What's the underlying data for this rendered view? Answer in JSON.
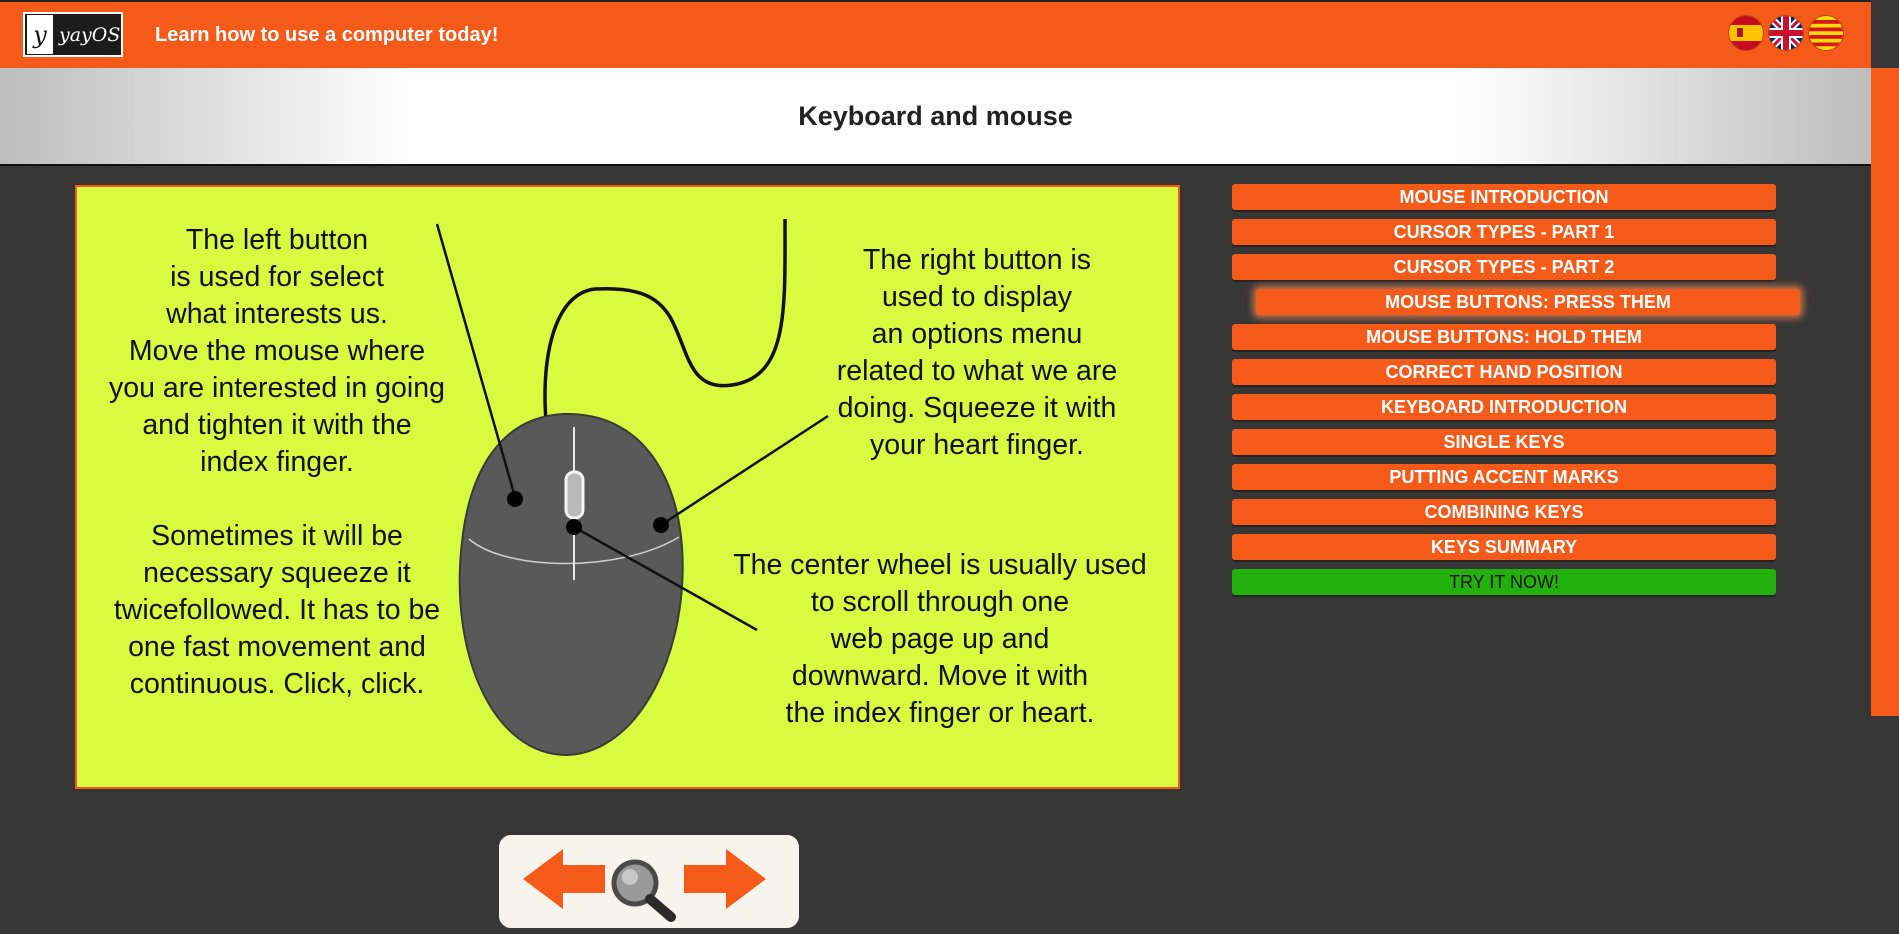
{
  "header": {
    "logo_letter": "y",
    "logo_text": "yayOS",
    "tagline": "Learn how to use a computer today!",
    "languages": [
      "spanish-flag",
      "uk-flag",
      "catalan-flag"
    ]
  },
  "page": {
    "title": "Keyboard and mouse"
  },
  "figure": {
    "left_button_text": "The left button\nis used for select\nwhat interests us.\nMove the mouse where\nyou are interested in going\nand tighten it with the\nindex finger.",
    "double_click_text": "Sometimes it will be\nnecessary squeeze it\ntwicefollowed. It has to be\none fast movement and\ncontinuous. Click, click.",
    "right_button_text": "The right button is\nused to display\nan options menu\nrelated to what we are\ndoing. Squeeze it with\nyour heart finger.",
    "wheel_text": "The center wheel is usually used\nto scroll through one\nweb page up and\ndownward. Move it with\nthe index finger or heart."
  },
  "menu": {
    "items": [
      {
        "label": "MOUSE INTRODUCTION"
      },
      {
        "label": "CURSOR TYPES - PART 1"
      },
      {
        "label": "CURSOR TYPES - PART 2"
      },
      {
        "label": "MOUSE BUTTONS: PRESS THEM"
      },
      {
        "label": "MOUSE BUTTONS: HOLD THEM"
      },
      {
        "label": "CORRECT HAND POSITION"
      },
      {
        "label": "KEYBOARD INTRODUCTION"
      },
      {
        "label": "SINGLE KEYS"
      },
      {
        "label": "PUTTING ACCENT MARKS"
      },
      {
        "label": "COMBINING KEYS"
      },
      {
        "label": "KEYS SUMMARY"
      },
      {
        "label": "TRY IT NOW!"
      }
    ],
    "active_index": 3
  },
  "nav": {
    "icons": [
      "arrow-left-icon",
      "magnifier-icon",
      "arrow-right-icon"
    ]
  },
  "colors": {
    "brand_orange": "#f55a19",
    "figure_bg": "#d8fb3f",
    "try_green": "#22b10b",
    "page_bg": "#363636"
  }
}
